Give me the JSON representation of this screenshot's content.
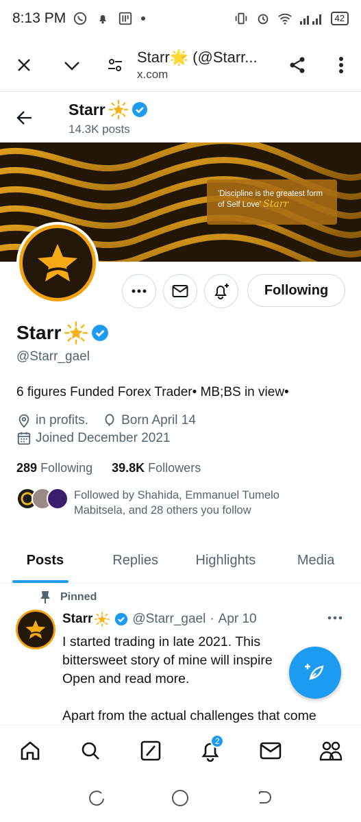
{
  "status_bar": {
    "time": "8:13 PM",
    "battery": "42"
  },
  "browser": {
    "title": "Starr🌟 (@Starr...",
    "domain": "x.com"
  },
  "profile_header": {
    "name": "Starr",
    "posts": "14.3K posts"
  },
  "banner": {
    "quote": "'Discipline is the greatest form of Self Love'",
    "signature": "Starr"
  },
  "actions": {
    "following_label": "Following"
  },
  "profile": {
    "name": "Starr",
    "handle": "@Starr_gael",
    "bio": "6 figures Funded Forex Trader• MB;BS in view•",
    "location": "in profits.",
    "birthday": "Born April 14",
    "joined": "Joined December 2021",
    "following_count": "289",
    "following_label": "Following",
    "followers_count": "39.8K",
    "followers_label": "Followers",
    "followed_by": "Followed by Shahida, Emmanuel Tumelo Mabitsela, and 28 others you follow"
  },
  "tabs": [
    {
      "label": "Posts",
      "active": true
    },
    {
      "label": "Replies"
    },
    {
      "label": "Highlights"
    },
    {
      "label": "Media"
    }
  ],
  "pinned_tweet": {
    "pinned_label": "Pinned",
    "name": "Starr",
    "handle": "@Starr_gael",
    "dot": "·",
    "date": "Apr 10",
    "line1": "I started trading in late 2021. This",
    "line2": "bittersweet story of mine will inspire",
    "line3": "Open and read more.",
    "line4": "Apart from the actual challenges that come"
  },
  "bottom_nav": {
    "notifications_badge": "2"
  },
  "colors": {
    "accent": "#1d9bf0",
    "gold": "#f2a20f",
    "text": "#0f1419",
    "muted": "#536471"
  }
}
